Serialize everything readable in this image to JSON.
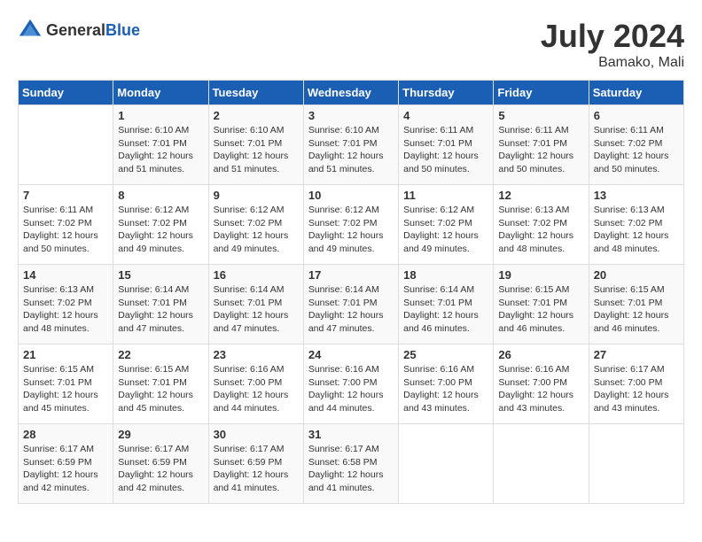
{
  "header": {
    "logo_general": "General",
    "logo_blue": "Blue",
    "month_title": "July 2024",
    "location": "Bamako, Mali"
  },
  "calendar": {
    "days_of_week": [
      "Sunday",
      "Monday",
      "Tuesday",
      "Wednesday",
      "Thursday",
      "Friday",
      "Saturday"
    ],
    "weeks": [
      [
        {
          "day": "",
          "sunrise": "",
          "sunset": "",
          "daylight": ""
        },
        {
          "day": "1",
          "sunrise": "Sunrise: 6:10 AM",
          "sunset": "Sunset: 7:01 PM",
          "daylight": "Daylight: 12 hours and 51 minutes."
        },
        {
          "day": "2",
          "sunrise": "Sunrise: 6:10 AM",
          "sunset": "Sunset: 7:01 PM",
          "daylight": "Daylight: 12 hours and 51 minutes."
        },
        {
          "day": "3",
          "sunrise": "Sunrise: 6:10 AM",
          "sunset": "Sunset: 7:01 PM",
          "daylight": "Daylight: 12 hours and 51 minutes."
        },
        {
          "day": "4",
          "sunrise": "Sunrise: 6:11 AM",
          "sunset": "Sunset: 7:01 PM",
          "daylight": "Daylight: 12 hours and 50 minutes."
        },
        {
          "day": "5",
          "sunrise": "Sunrise: 6:11 AM",
          "sunset": "Sunset: 7:01 PM",
          "daylight": "Daylight: 12 hours and 50 minutes."
        },
        {
          "day": "6",
          "sunrise": "Sunrise: 6:11 AM",
          "sunset": "Sunset: 7:02 PM",
          "daylight": "Daylight: 12 hours and 50 minutes."
        }
      ],
      [
        {
          "day": "7",
          "sunrise": "Sunrise: 6:11 AM",
          "sunset": "Sunset: 7:02 PM",
          "daylight": "Daylight: 12 hours and 50 minutes."
        },
        {
          "day": "8",
          "sunrise": "Sunrise: 6:12 AM",
          "sunset": "Sunset: 7:02 PM",
          "daylight": "Daylight: 12 hours and 49 minutes."
        },
        {
          "day": "9",
          "sunrise": "Sunrise: 6:12 AM",
          "sunset": "Sunset: 7:02 PM",
          "daylight": "Daylight: 12 hours and 49 minutes."
        },
        {
          "day": "10",
          "sunrise": "Sunrise: 6:12 AM",
          "sunset": "Sunset: 7:02 PM",
          "daylight": "Daylight: 12 hours and 49 minutes."
        },
        {
          "day": "11",
          "sunrise": "Sunrise: 6:12 AM",
          "sunset": "Sunset: 7:02 PM",
          "daylight": "Daylight: 12 hours and 49 minutes."
        },
        {
          "day": "12",
          "sunrise": "Sunrise: 6:13 AM",
          "sunset": "Sunset: 7:02 PM",
          "daylight": "Daylight: 12 hours and 48 minutes."
        },
        {
          "day": "13",
          "sunrise": "Sunrise: 6:13 AM",
          "sunset": "Sunset: 7:02 PM",
          "daylight": "Daylight: 12 hours and 48 minutes."
        }
      ],
      [
        {
          "day": "14",
          "sunrise": "Sunrise: 6:13 AM",
          "sunset": "Sunset: 7:02 PM",
          "daylight": "Daylight: 12 hours and 48 minutes."
        },
        {
          "day": "15",
          "sunrise": "Sunrise: 6:14 AM",
          "sunset": "Sunset: 7:01 PM",
          "daylight": "Daylight: 12 hours and 47 minutes."
        },
        {
          "day": "16",
          "sunrise": "Sunrise: 6:14 AM",
          "sunset": "Sunset: 7:01 PM",
          "daylight": "Daylight: 12 hours and 47 minutes."
        },
        {
          "day": "17",
          "sunrise": "Sunrise: 6:14 AM",
          "sunset": "Sunset: 7:01 PM",
          "daylight": "Daylight: 12 hours and 47 minutes."
        },
        {
          "day": "18",
          "sunrise": "Sunrise: 6:14 AM",
          "sunset": "Sunset: 7:01 PM",
          "daylight": "Daylight: 12 hours and 46 minutes."
        },
        {
          "day": "19",
          "sunrise": "Sunrise: 6:15 AM",
          "sunset": "Sunset: 7:01 PM",
          "daylight": "Daylight: 12 hours and 46 minutes."
        },
        {
          "day": "20",
          "sunrise": "Sunrise: 6:15 AM",
          "sunset": "Sunset: 7:01 PM",
          "daylight": "Daylight: 12 hours and 46 minutes."
        }
      ],
      [
        {
          "day": "21",
          "sunrise": "Sunrise: 6:15 AM",
          "sunset": "Sunset: 7:01 PM",
          "daylight": "Daylight: 12 hours and 45 minutes."
        },
        {
          "day": "22",
          "sunrise": "Sunrise: 6:15 AM",
          "sunset": "Sunset: 7:01 PM",
          "daylight": "Daylight: 12 hours and 45 minutes."
        },
        {
          "day": "23",
          "sunrise": "Sunrise: 6:16 AM",
          "sunset": "Sunset: 7:00 PM",
          "daylight": "Daylight: 12 hours and 44 minutes."
        },
        {
          "day": "24",
          "sunrise": "Sunrise: 6:16 AM",
          "sunset": "Sunset: 7:00 PM",
          "daylight": "Daylight: 12 hours and 44 minutes."
        },
        {
          "day": "25",
          "sunrise": "Sunrise: 6:16 AM",
          "sunset": "Sunset: 7:00 PM",
          "daylight": "Daylight: 12 hours and 43 minutes."
        },
        {
          "day": "26",
          "sunrise": "Sunrise: 6:16 AM",
          "sunset": "Sunset: 7:00 PM",
          "daylight": "Daylight: 12 hours and 43 minutes."
        },
        {
          "day": "27",
          "sunrise": "Sunrise: 6:17 AM",
          "sunset": "Sunset: 7:00 PM",
          "daylight": "Daylight: 12 hours and 43 minutes."
        }
      ],
      [
        {
          "day": "28",
          "sunrise": "Sunrise: 6:17 AM",
          "sunset": "Sunset: 6:59 PM",
          "daylight": "Daylight: 12 hours and 42 minutes."
        },
        {
          "day": "29",
          "sunrise": "Sunrise: 6:17 AM",
          "sunset": "Sunset: 6:59 PM",
          "daylight": "Daylight: 12 hours and 42 minutes."
        },
        {
          "day": "30",
          "sunrise": "Sunrise: 6:17 AM",
          "sunset": "Sunset: 6:59 PM",
          "daylight": "Daylight: 12 hours and 41 minutes."
        },
        {
          "day": "31",
          "sunrise": "Sunrise: 6:17 AM",
          "sunset": "Sunset: 6:58 PM",
          "daylight": "Daylight: 12 hours and 41 minutes."
        },
        {
          "day": "",
          "sunrise": "",
          "sunset": "",
          "daylight": ""
        },
        {
          "day": "",
          "sunrise": "",
          "sunset": "",
          "daylight": ""
        },
        {
          "day": "",
          "sunrise": "",
          "sunset": "",
          "daylight": ""
        }
      ]
    ]
  }
}
